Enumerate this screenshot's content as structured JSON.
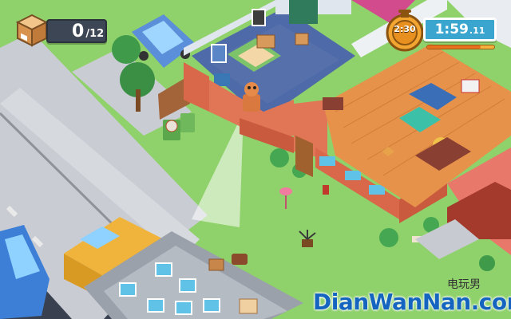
{
  "hud": {
    "boxes_delivered": "0",
    "boxes_separator": "/",
    "boxes_total": "12",
    "medal_time": "2:30",
    "timer_main": "1:59",
    "timer_sub": ".11",
    "timer_progress": 0.8
  },
  "watermark": {
    "cn": "电玩男",
    "en": "DianWanNan.com"
  },
  "colors": {
    "grass": "#8fd16a",
    "road": "#3a3f4a",
    "sidewalk": "#c7cbd1",
    "floor_wood": "#e6924a",
    "floor_blue": "#4f6aa8",
    "brick": "#d9684a",
    "hud_dark": "#3d4654",
    "timer_blue": "#3aa6cf",
    "medal_gold": "#f2a531"
  }
}
